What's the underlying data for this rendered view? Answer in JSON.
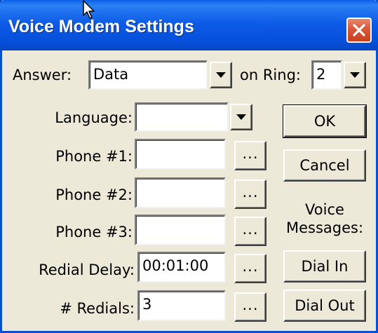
{
  "window": {
    "title": "Voice Modem Settings",
    "close_icon": "close-icon"
  },
  "answer": {
    "label": "Answer:",
    "value": "Data"
  },
  "ring": {
    "label": "on Ring:",
    "value": "2"
  },
  "language": {
    "label": "Language:",
    "value": ""
  },
  "phone1": {
    "label": "Phone #1:",
    "value": ""
  },
  "phone2": {
    "label": "Phone #2:",
    "value": ""
  },
  "phone3": {
    "label": "Phone #3:",
    "value": ""
  },
  "redial_delay": {
    "label": "Redial Delay:",
    "value": "00:01:00"
  },
  "redials": {
    "label": "# Redials:",
    "value": "3"
  },
  "browse_label": "...",
  "buttons": {
    "ok": "OK",
    "cancel": "Cancel",
    "dial_in": "Dial In",
    "dial_out": "Dial Out"
  },
  "voice_messages_label_line1": "Voice",
  "voice_messages_label_line2": "Messages:",
  "colors": {
    "title_bar": "#0a5ee8",
    "face": "#ece9d8",
    "close_button": "#d9573a"
  }
}
